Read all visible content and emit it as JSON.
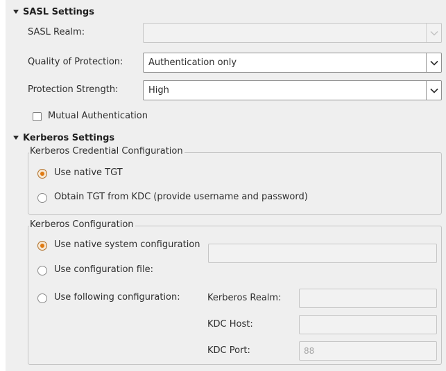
{
  "sasl": {
    "header": "SASL Settings",
    "realm_label": "SASL Realm:",
    "realm_value": "",
    "qop_label": "Quality of Protection:",
    "qop_value": "Authentication only",
    "strength_label": "Protection Strength:",
    "strength_value": "High",
    "mutual_label": "Mutual Authentication",
    "mutual_checked": false
  },
  "kerberos": {
    "header": "Kerberos Settings",
    "credential_group": {
      "title": "Kerberos Credential Configuration",
      "options": [
        {
          "label": "Use native TGT",
          "checked": true
        },
        {
          "label": "Obtain TGT from KDC (provide username and password)",
          "checked": false
        }
      ]
    },
    "config_group": {
      "title": "Kerberos Configuration",
      "options": [
        {
          "label": "Use native system configuration",
          "checked": true
        },
        {
          "label": "Use configuration file:",
          "checked": false
        },
        {
          "label": "Use following configuration:",
          "checked": false
        }
      ],
      "config_file_value": "",
      "realm_label": "Kerberos Realm:",
      "realm_value": "",
      "kdc_host_label": "KDC Host:",
      "kdc_host_value": "",
      "kdc_port_label": "KDC Port:",
      "kdc_port_value": "88"
    }
  },
  "icons": {
    "collapse": "triangle-down-icon",
    "dropdown": "chevron-down-icon"
  },
  "colors": {
    "panel_bg": "#efefef",
    "radio_accent": "#e07a12"
  }
}
